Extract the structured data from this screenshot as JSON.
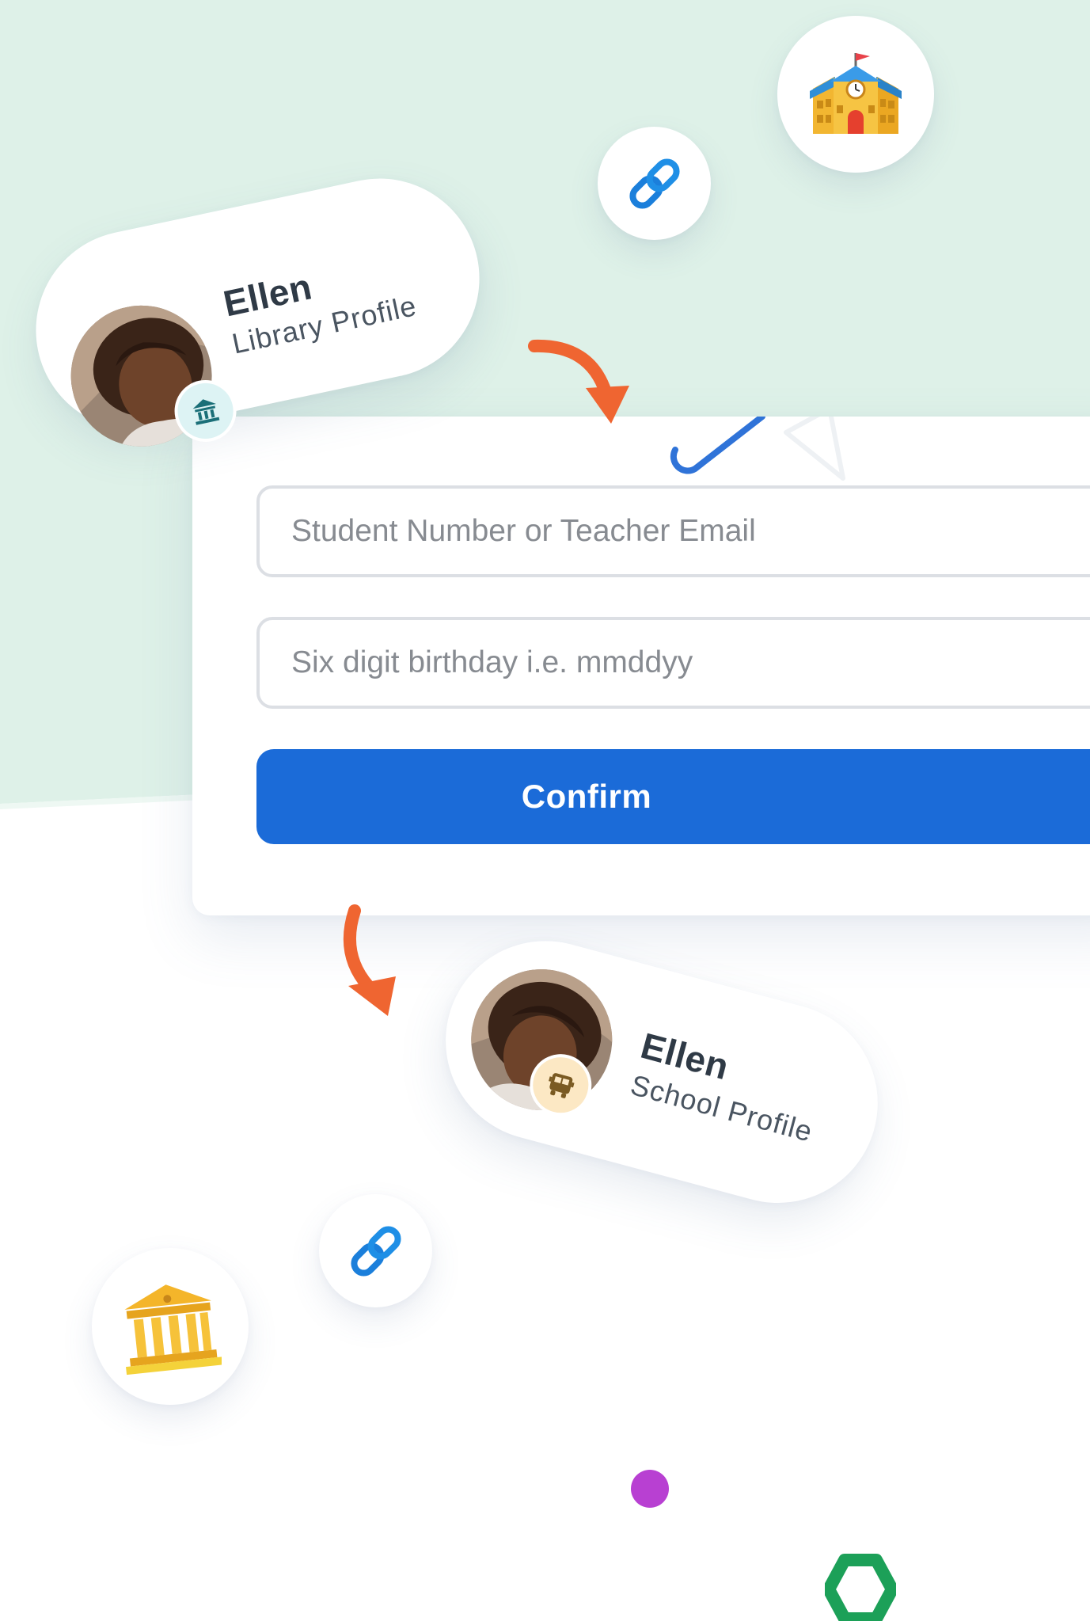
{
  "colors": {
    "mint_background": "#def1e8",
    "primary_button": "#1b6bd8",
    "arrow": "#ef6531",
    "library_badge": "#ddf3f4",
    "school_badge": "#fce8c4",
    "purple_dot": "#b840d2",
    "green_hexagon": "#1ca058"
  },
  "library_profile": {
    "name": "Ellen",
    "label": "Library Profile",
    "badge_icon": "library-icon"
  },
  "form": {
    "student_number_placeholder": "Student Number or Teacher Email",
    "birthday_placeholder": "Six digit birthday i.e. mmddyy",
    "confirm_label": "Confirm"
  },
  "school_profile": {
    "name": "Ellen",
    "label": "School Profile",
    "badge_icon": "school-bus-icon"
  },
  "decorations": {
    "icons": [
      "school-building-icon",
      "link-icon",
      "link-icon",
      "classical-building-icon",
      "paperclip-icon",
      "paper-plane-icon",
      "arrow-icon",
      "arrow-icon"
    ]
  }
}
